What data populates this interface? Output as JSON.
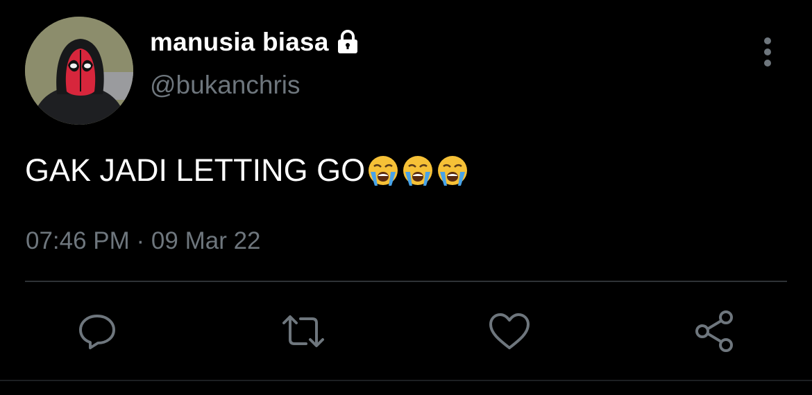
{
  "tweet": {
    "display_name": "manusia biasa",
    "handle": "@bukanchris",
    "text": "GAK JADI LETTING GO",
    "emojis": [
      "loudly-crying-face",
      "loudly-crying-face",
      "loudly-crying-face"
    ],
    "timestamp": "07:46 PM · 09 Mar 22",
    "protected": true
  },
  "actions": [
    "reply-icon",
    "retweet-icon",
    "like-icon",
    "share-icon"
  ],
  "colors": {
    "background": "#000000",
    "primary_text": "#ffffff",
    "secondary_text": "#6e767d",
    "divider": "#2f3336"
  }
}
